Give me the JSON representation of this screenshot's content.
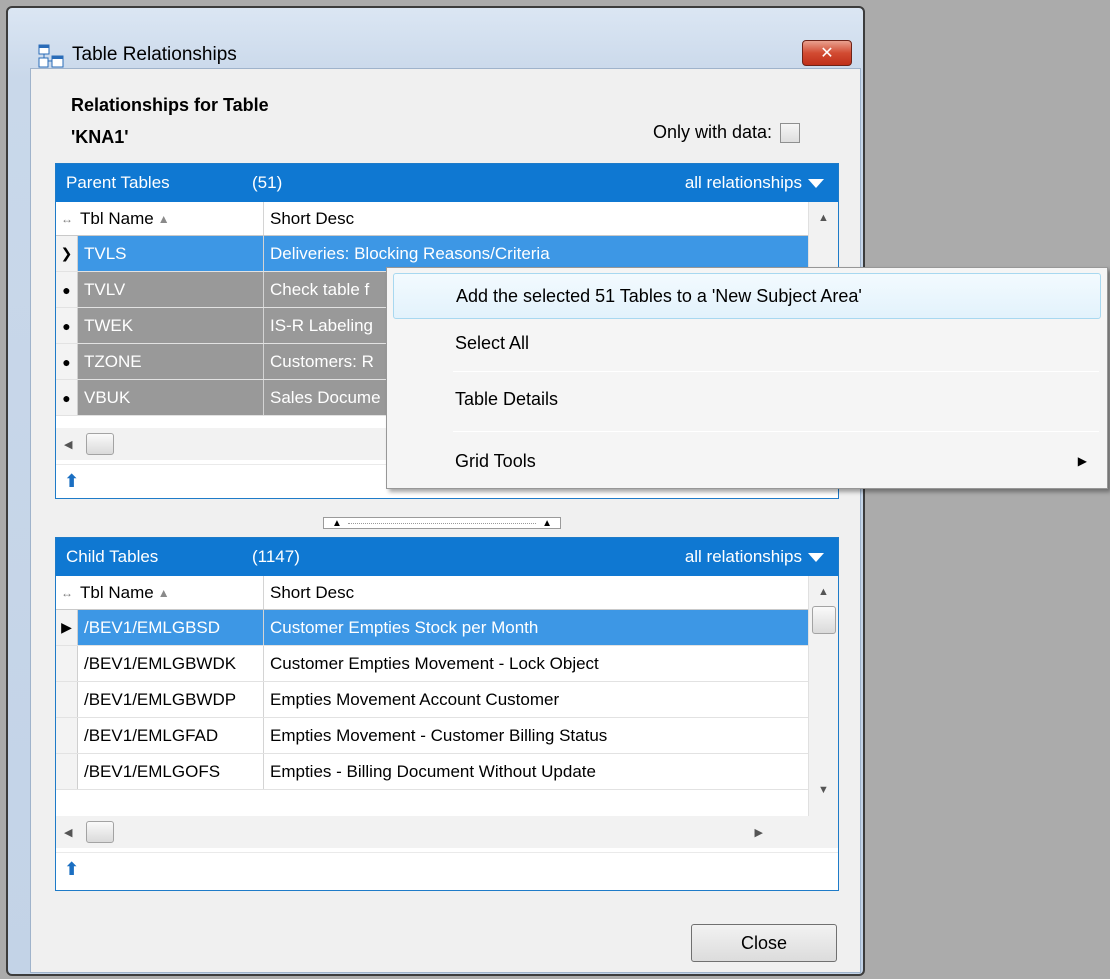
{
  "window": {
    "title": "Table Relationships",
    "close_glyph": "✕"
  },
  "header": {
    "heading_line1": "Relationships for Table",
    "heading_line2": "'KNA1'",
    "only_with_data_label": "Only with data:"
  },
  "parent": {
    "title": "Parent Tables",
    "count": "(51)",
    "filter": "all relationships",
    "columns": {
      "name": "Tbl Name",
      "desc": "Short Desc"
    },
    "rows": [
      {
        "name": "TVLS",
        "desc": "Deliveries: Blocking Reasons/Criteria"
      },
      {
        "name": "TVLV",
        "desc": "Check table f"
      },
      {
        "name": "TWEK",
        "desc": "IS-R Labeling"
      },
      {
        "name": "TZONE",
        "desc": "Customers: R"
      },
      {
        "name": "VBUK",
        "desc": "Sales Docume"
      }
    ]
  },
  "child": {
    "title": "Child Tables",
    "count": "(1147)",
    "filter": "all relationships",
    "columns": {
      "name": "Tbl Name",
      "desc": "Short Desc"
    },
    "rows": [
      {
        "name": "/BEV1/EMLGBSD",
        "desc": "Customer Empties Stock per Month"
      },
      {
        "name": "/BEV1/EMLGBWDK",
        "desc": "Customer Empties Movement - Lock Object"
      },
      {
        "name": "/BEV1/EMLGBWDP",
        "desc": "Empties Movement Account Customer"
      },
      {
        "name": "/BEV1/EMLGFAD",
        "desc": "Empties Movement - Customer Billing Status"
      },
      {
        "name": "/BEV1/EMLGOFS",
        "desc": "Empties - Billing Document Without Update"
      }
    ]
  },
  "context_menu": {
    "items": [
      "Add the selected 51 Tables to a 'New Subject Area'",
      "Select All",
      "Table Details",
      "Grid Tools"
    ]
  },
  "buttons": {
    "close": "Close"
  },
  "icons": {
    "window": "table-relationships-icon",
    "sort": "sort-asc-icon",
    "navigate_up": "navigate-up-icon"
  }
}
